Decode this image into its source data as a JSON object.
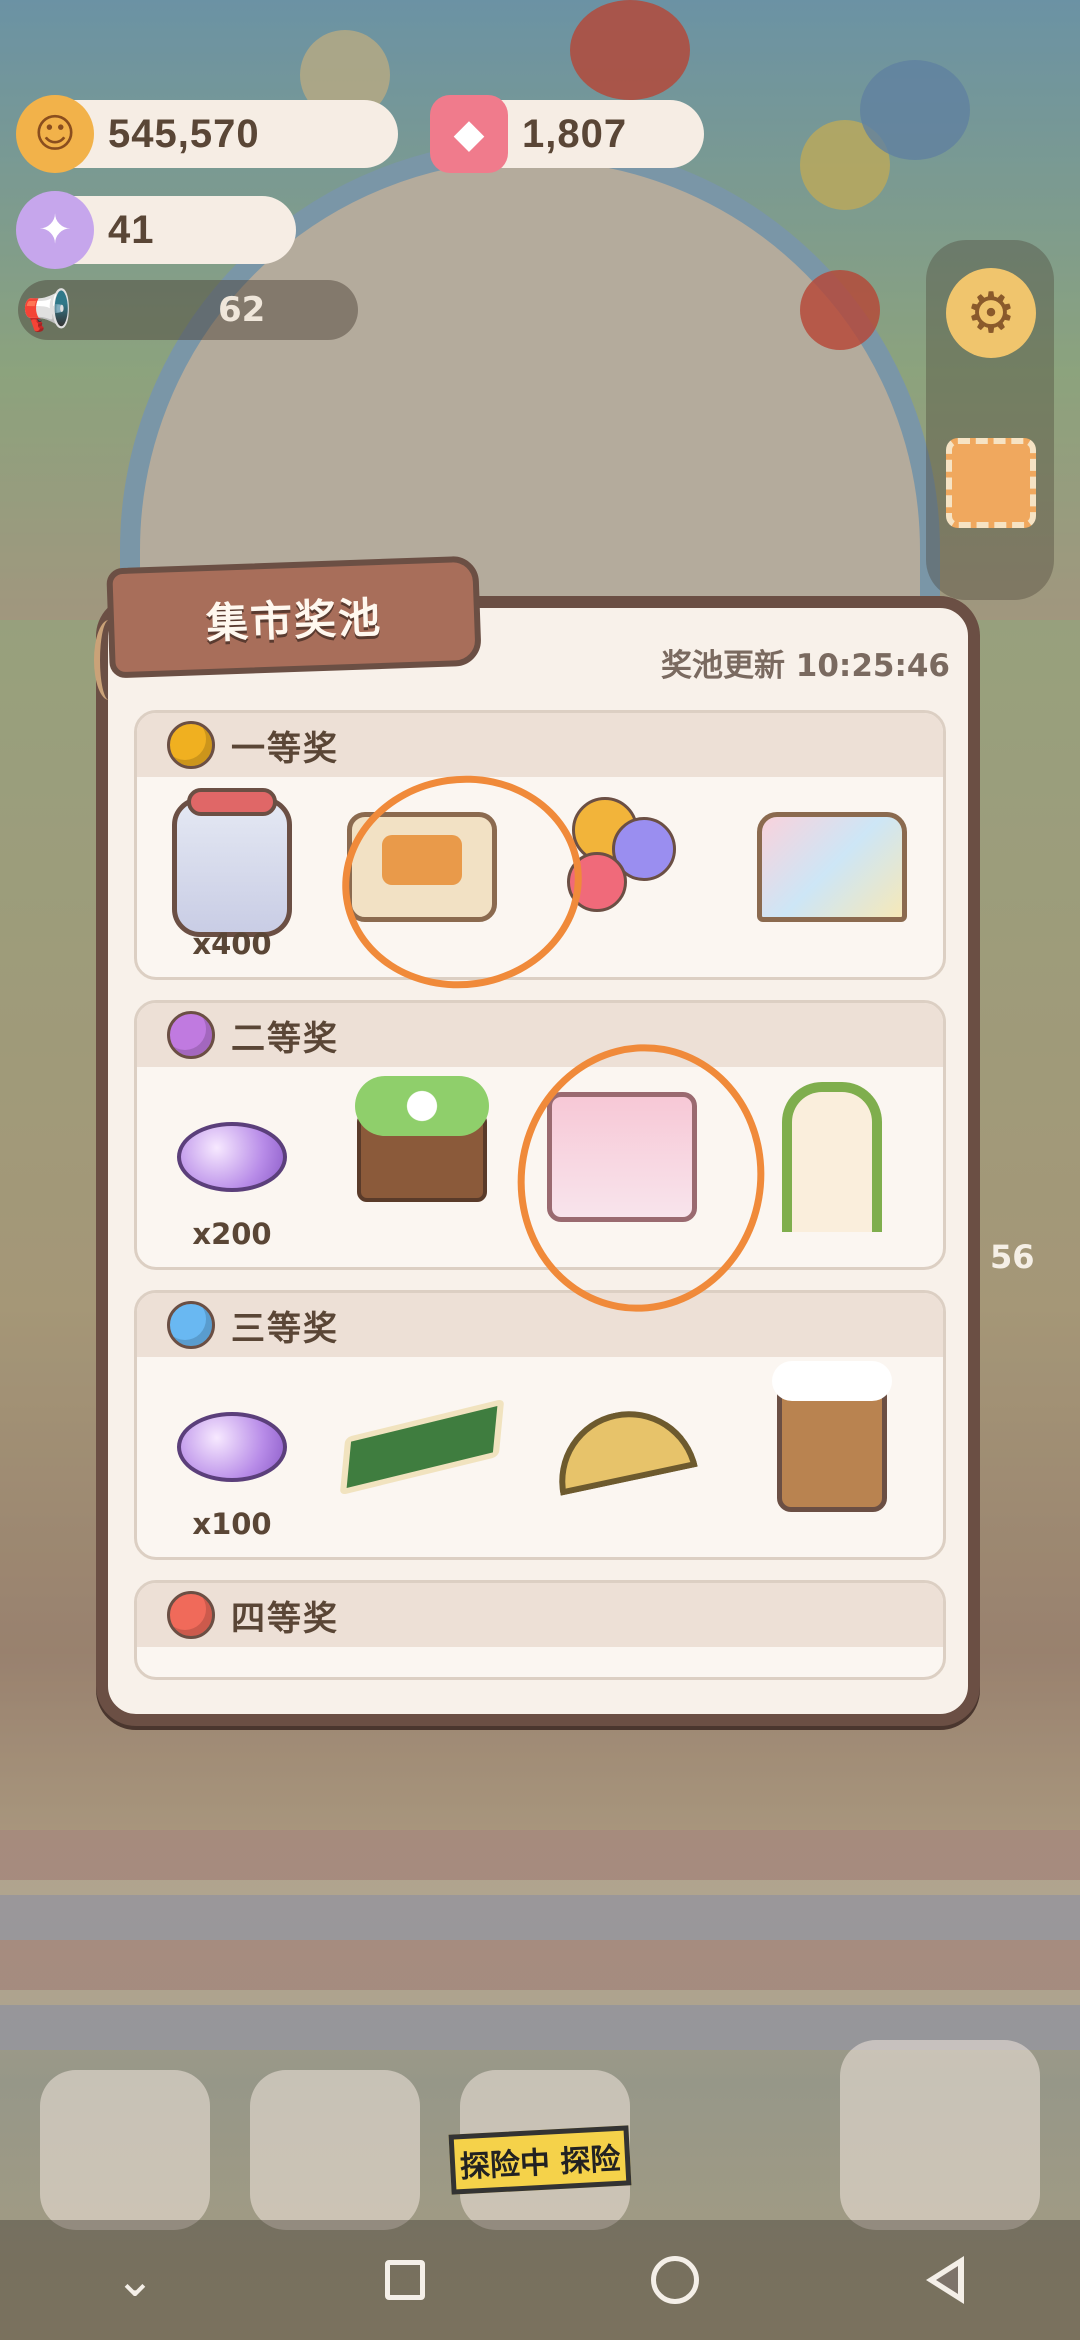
{
  "resources": {
    "cookies": "545,570",
    "gems": "1,807",
    "candy": "41",
    "announcement_count": "62"
  },
  "side_badge": "56",
  "panel": {
    "title": "集市奖池",
    "refresh_text": "奖池更新 10:25:46",
    "tiers": [
      {
        "label": "一等奖",
        "dot_color": "#f0b020",
        "items": [
          {
            "icon": "candy-jar-icon",
            "qty": "x400"
          },
          {
            "icon": "bbq-stall-icon",
            "qty": ""
          },
          {
            "icon": "balloons-icon",
            "qty": ""
          },
          {
            "icon": "slide-icon",
            "qty": ""
          }
        ]
      },
      {
        "label": "二等奖",
        "dot_color": "#c07ae0",
        "items": [
          {
            "icon": "candy-bundle-icon",
            "qty": "x200"
          },
          {
            "icon": "flower-bed-icon",
            "qty": ""
          },
          {
            "icon": "cake-shelf-icon",
            "qty": ""
          },
          {
            "icon": "vine-arbor-icon",
            "qty": ""
          }
        ]
      },
      {
        "label": "三等奖",
        "dot_color": "#69b8f2",
        "items": [
          {
            "icon": "candy-pair-icon",
            "qty": "x100"
          },
          {
            "icon": "flower-rug-icon",
            "qty": ""
          },
          {
            "icon": "melon-slice-icon",
            "qty": ""
          },
          {
            "icon": "cuckoo-clock-icon",
            "qty": ""
          }
        ]
      },
      {
        "label": "四等奖",
        "dot_color": "#f06a5a",
        "items": []
      }
    ]
  },
  "bottom_banner": "探险中 探险",
  "colors": {
    "panel_bg": "#f8f1ea",
    "panel_border": "#6b4f44",
    "tag_bg": "#a86e5a",
    "annotation": "#f08a3a"
  }
}
